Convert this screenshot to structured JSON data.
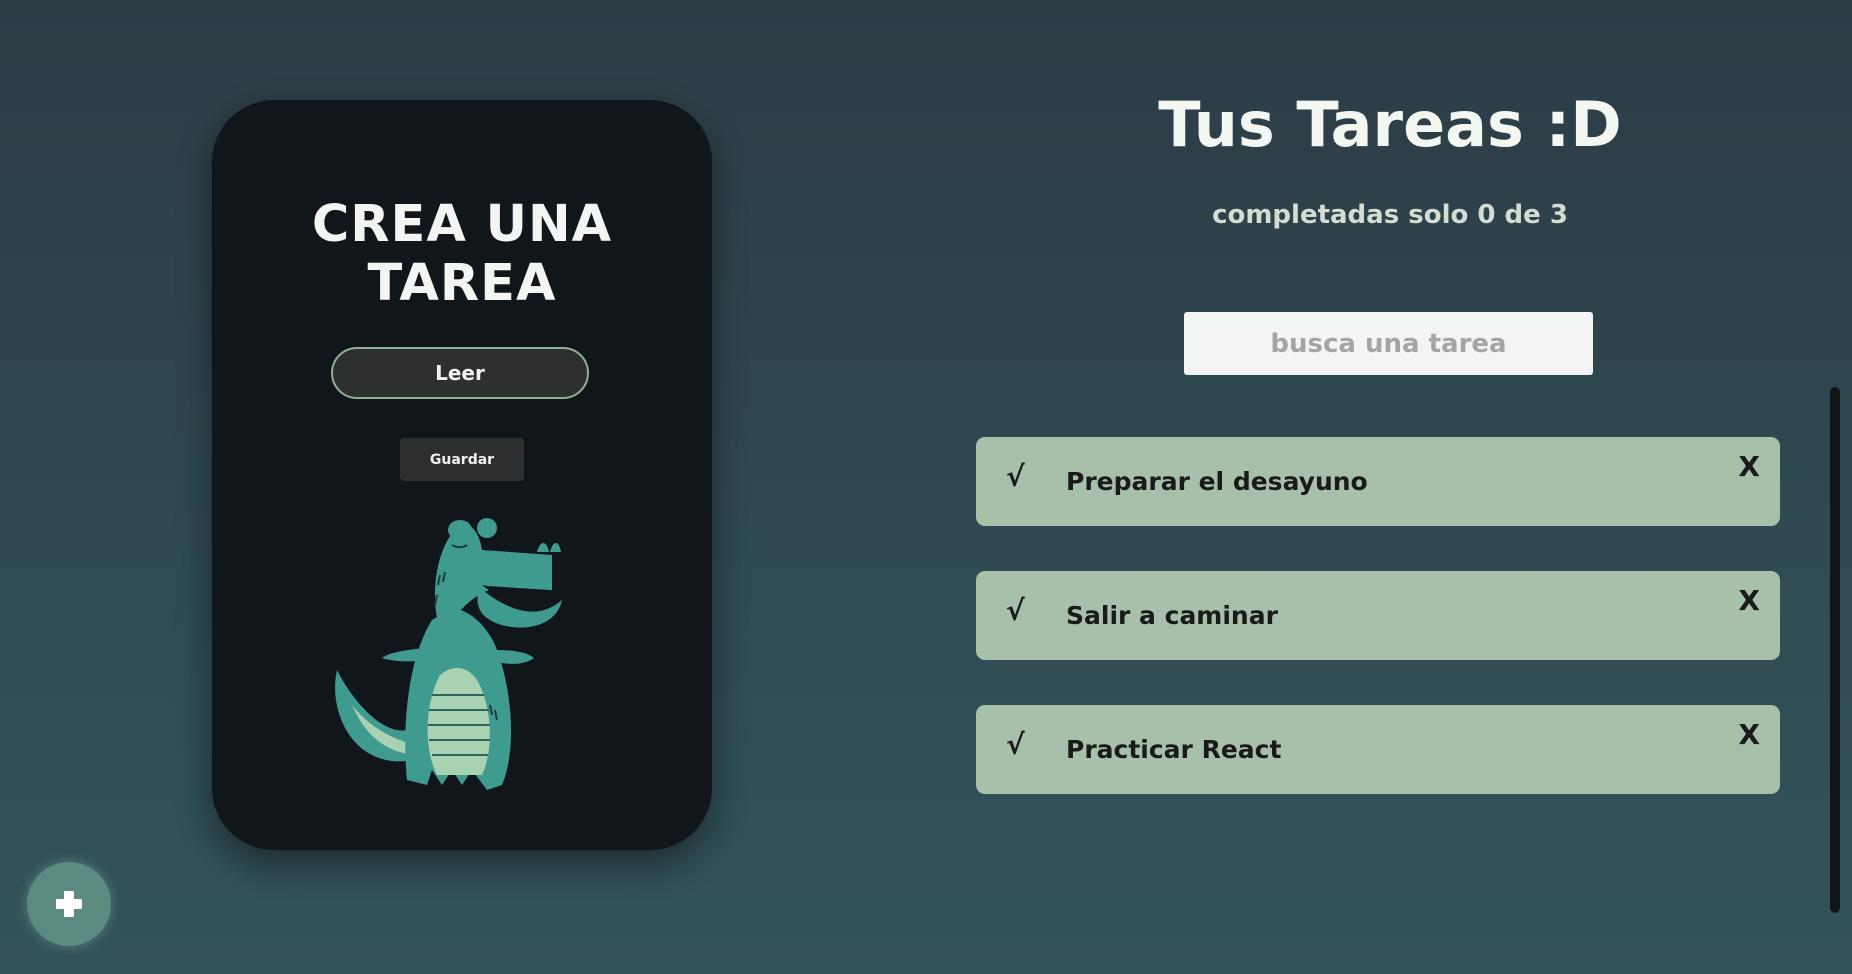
{
  "create_panel": {
    "title": "CREA UNA TAREA",
    "input_value": "Leer",
    "save_label": "Guardar"
  },
  "main": {
    "title": "Tus Tareas :D",
    "counter_text": "completadas solo 0 de 3",
    "search_placeholder": "busca una tarea"
  },
  "todos": [
    {
      "check_icon": "√",
      "text": "Preparar el desayuno",
      "delete_icon": "X",
      "completed": false
    },
    {
      "check_icon": "√",
      "text": "Salir a caminar",
      "delete_icon": "X",
      "completed": false
    },
    {
      "check_icon": "√",
      "text": "Practicar React",
      "delete_icon": "X",
      "completed": false
    }
  ],
  "colors": {
    "background": "#2f4a52",
    "card": "#101619",
    "todo_item": "#a6c0a9",
    "accent": "#5a8a80",
    "crocodile": "#3f9a90"
  },
  "icons": {
    "fab": "plus-icon",
    "illustration": "crocodile-illustration"
  }
}
